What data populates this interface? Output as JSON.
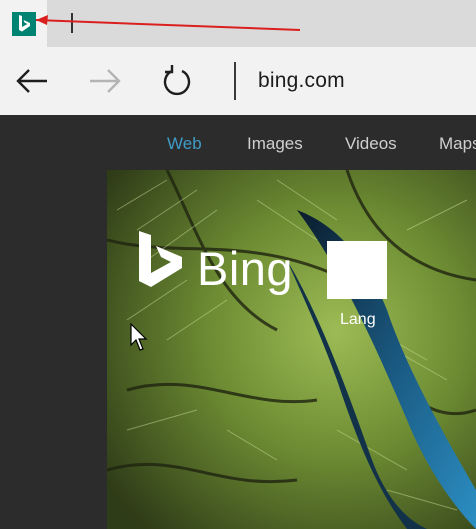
{
  "browser": {
    "tabs": [
      {
        "favicon": "bing-b-icon",
        "title": ""
      }
    ],
    "address_bar": {
      "url": "bing.com"
    },
    "nav_icons": [
      "back-arrow-icon",
      "forward-arrow-icon",
      "refresh-icon"
    ]
  },
  "page": {
    "nav": [
      {
        "label": "Web",
        "active": true
      },
      {
        "label": "Images",
        "active": false
      },
      {
        "label": "Videos",
        "active": false
      },
      {
        "label": "Maps",
        "active": false
      }
    ],
    "logo_text": "Bing",
    "search_placeholder": "",
    "language_text": "Lang"
  },
  "colors": {
    "favicon": "#008373",
    "annotation_arrow": "#d9201e",
    "active_nav": "#3f9bc6",
    "page_bg": "#2c2c2c"
  }
}
